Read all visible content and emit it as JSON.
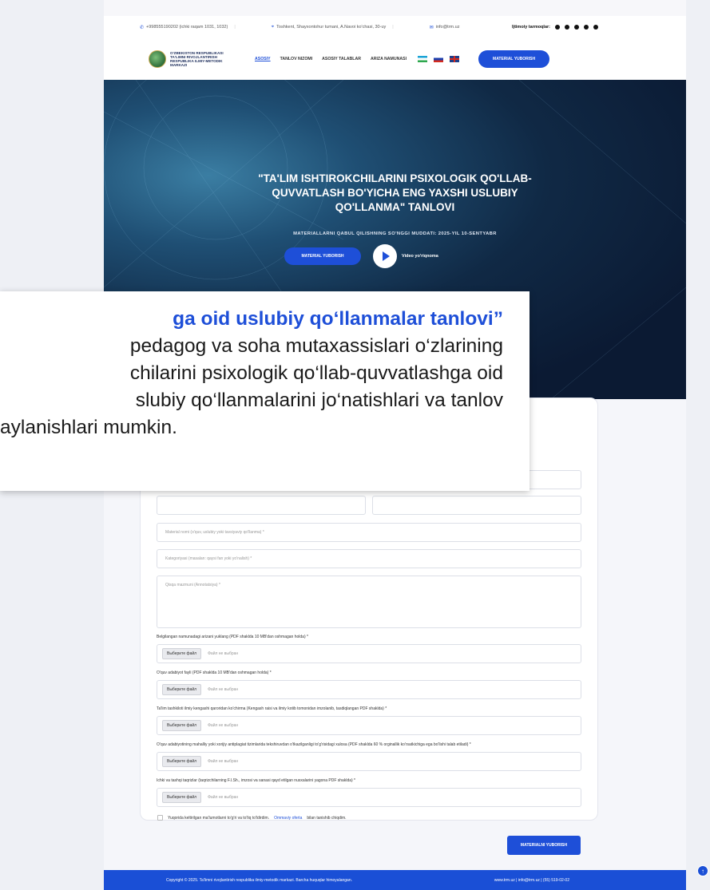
{
  "topbar": {
    "phone": "+998555190202 (ichki raqam 1031, 1032)",
    "address": "Toshkent, Shayxontohur tumani, A.Navoi ko'chasi, 30-uy",
    "email": "info@trm.uz",
    "social_label": "Ijtimoiy tarmoqlar:",
    "icons": [
      "telegram-icon",
      "facebook-icon",
      "instagram-icon",
      "twitter-icon",
      "youtube-icon"
    ]
  },
  "header": {
    "logo_text": "O'ZBEKISTON RESPUBLIKASI TA'LIMNI RIVOJLANTIRISH RESPUBLIKA ILMIY-METODIK MARKAZI",
    "nav": [
      "ASOSIY",
      "TANLOV NIZOMI",
      "ASOSIY TALABLAR",
      "ARIZA NAMUNASI"
    ],
    "cta": "MATERIAL YUBORISH"
  },
  "hero": {
    "title_line1": "\"TA'LIM ISHTIROKCHILARINI PSIXOLOGIK QO'LLAB-",
    "title_line2": "QUVVATLASH BO'YICHA ENG YAXSHI USLUBIY",
    "title_line3": "QO'LLANMA\" TANLOVI",
    "subtitle": "MATERIALLARNI QABUL QILISHNING SO'NGGI MUDDATI: 2025-YIL 10-SENTYABR",
    "button": "MATERIAL YUBORISH",
    "video_label": "Video yo'riqnoma"
  },
  "form": {
    "material_name_placeholder": "Material nomi (o'quv, uslubiy yoki tavsiyaviy qo'llanma) *",
    "category_placeholder": "Kategoriyasi (masalan: qaysi fan yoki yo'nalish) *",
    "summary_placeholder": "Qisqa mazmuni (Annotatsiya) *",
    "file_button": "Выберите файл",
    "file_none": "Файл не выбран",
    "file_labels": [
      "Belgilangan namunadagi arizani yuklang (PDF shaklda 10 MB'dan oshmagan holda) *",
      "O'quv adabiyot fayli (PDF shaklda 10 MB'dan oshmagan holda) *",
      "Ta'lim tashkiloti ilmiy kengashi qaroridan ko'chirma (Kengash raisi va ilmiy kotib tomonidan imzolanib, tasdiqlangan PDF shaklda) *",
      "O'quv adabiyotining mahalliy yoki xorijiy antiplagiat tizimlarida tekshiruvdan o'tkazilganligi to'g'risidagi xulosa (PDF shaklda 60 % orginallik ko'rsatkichiga ega bo'lishi talab etiladi) *",
      "Ichki va tashqi taqrizlar (taqrizchilarning F.I.Sh., imzosi va sanasi qayd etilgan nusxalarini yagona PDF shaklda) *"
    ],
    "consent_text": "Yuqorida keltirilgan ma'lumotlarni to'g'ri va to'liq to'ldirdim.",
    "consent_link": "Ommaviy oferta",
    "consent_tail": "bilan tanishib chiqdim.",
    "submit": "MATERIALNI YUBORISH"
  },
  "footer": {
    "copyright": "Copyright © 2025. Ta'limni rivojlantirish respublika ilmiy-metodik markazi. Barcha huquqlar himoyalangan.",
    "contacts": "www.trm.uz  |  info@trm.uz  |  (55) 519-02-02"
  },
  "overlay": {
    "line1": "ga oid uslubiy qo‘llanmalar tanlovi”",
    "line2": "pedagog va soha mutaxassislari o‘zlarining",
    "line3": "chilarini psixologik qo‘llab-quvvatlashga oid",
    "line4": "slubiy qo‘llanmalarini jo‘natishlari va tanlov",
    "line5": "aylanishlari mumkin."
  },
  "colors": {
    "accent": "#1e4fd8",
    "footer": "#1a4fd6",
    "hero_dark": "#0b1a33"
  }
}
